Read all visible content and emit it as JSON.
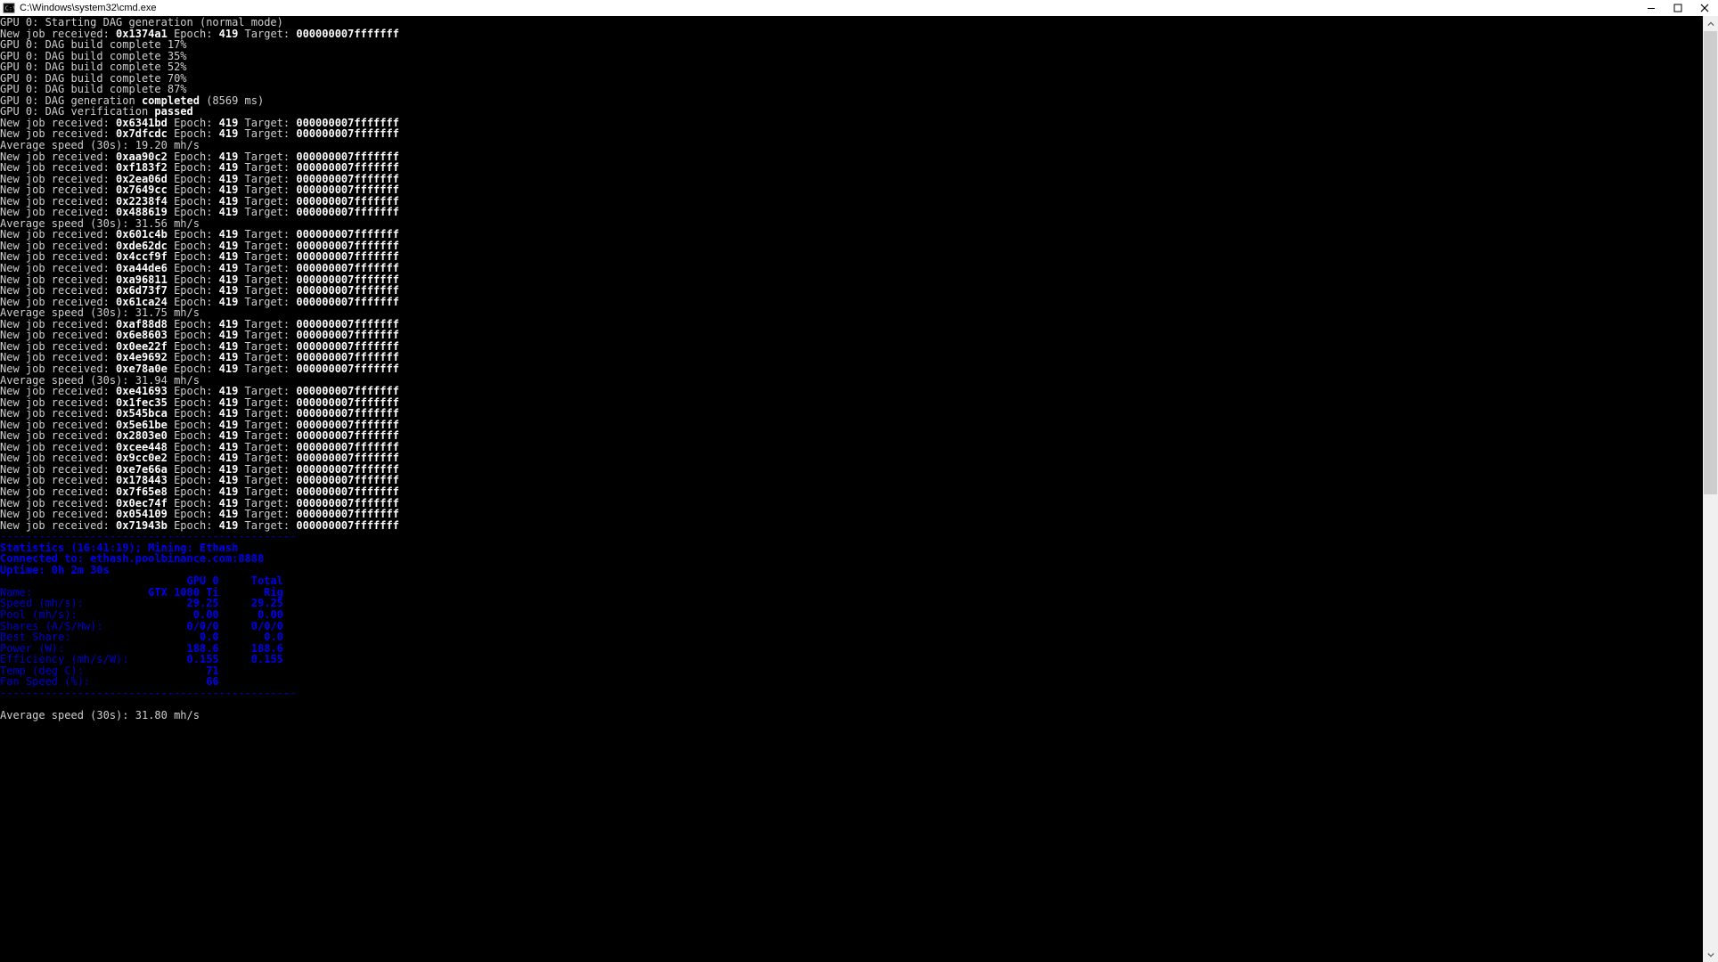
{
  "window": {
    "title": "C:\\Windows\\system32\\cmd.exe"
  },
  "log": {
    "epoch_label": "Epoch:",
    "epoch": "419",
    "target_label": "Target:",
    "target": "000000007fffffff",
    "lines": [
      "GPU 0: Starting DAG generation (normal mode)",
      {
        "job": "0x1374a1"
      },
      "GPU 0: DAG build complete 17%",
      "GPU 0: DAG build complete 35%",
      "GPU 0: DAG build complete 52%",
      "GPU 0: DAG build complete 70%",
      "GPU 0: DAG build complete 87%",
      {
        "dag_complete_prefix": "GPU 0: DAG generation ",
        "dag_complete_bold": "completed",
        "dag_complete_suffix": " (8569 ms)"
      },
      {
        "dag_verify_prefix": "GPU 0: DAG verification ",
        "dag_verify_bold": "passed"
      },
      {
        "job": "0x6341bd"
      },
      {
        "job": "0x7dfcdc"
      },
      "Average speed (30s): 19.20 mh/s",
      {
        "job": "0xaa90c2"
      },
      {
        "job": "0xf183f2"
      },
      {
        "job": "0x2ea06d"
      },
      {
        "job": "0x7649cc"
      },
      {
        "job": "0x2238f4"
      },
      {
        "job": "0x488619"
      },
      "Average speed (30s): 31.56 mh/s",
      {
        "job": "0x601c4b"
      },
      {
        "job": "0xde62dc"
      },
      {
        "job": "0x4ccf9f"
      },
      {
        "job": "0xa44de6"
      },
      {
        "job": "0xa96811"
      },
      {
        "job": "0x6d73f7"
      },
      {
        "job": "0x61ca24"
      },
      "Average speed (30s): 31.75 mh/s",
      {
        "job": "0xaf88d8"
      },
      {
        "job": "0x6e8603"
      },
      {
        "job": "0x0ee22f"
      },
      {
        "job": "0x4e9692"
      },
      {
        "job": "0xe78a0e"
      },
      "Average speed (30s): 31.94 mh/s",
      {
        "job": "0xe41693"
      },
      {
        "job": "0x1fec35"
      },
      {
        "job": "0x545bca"
      },
      {
        "job": "0x5e61be"
      },
      {
        "job": "0x2803e0"
      },
      {
        "job": "0xcee448"
      },
      {
        "job": "0x9cc0e2"
      },
      {
        "job": "0xe7e66a"
      },
      {
        "job": "0x178443"
      },
      {
        "job": "0x7f65e8"
      },
      {
        "job": "0x0ec74f"
      },
      {
        "job": "0x054109"
      },
      {
        "job": "0x71943b"
      }
    ]
  },
  "stats": {
    "dash_top": "----------------------------------------------",
    "header": "Statistics (16:41:19); Mining: Ethash",
    "connected": "Connected to: ethash.poolbinance.com:8888",
    "uptime": "Uptime: 0h 2m 30s",
    "col_gpu": "GPU 0",
    "col_total": "Total",
    "rows": [
      {
        "label": "Name:",
        "gpu": "GTX 1080 Ti",
        "total": "Rig"
      },
      {
        "label": "Speed (mh/s):",
        "gpu": "29.25",
        "total": "29.25"
      },
      {
        "label": "Pool (mh/s):",
        "gpu": "0.00",
        "total": "0.00"
      },
      {
        "label": "Shares (A/S/Hw):",
        "gpu": "0/0/0",
        "total": "0/0/0"
      },
      {
        "label": "Best Share:",
        "gpu": "0.0",
        "total": "0.0"
      },
      {
        "label": "Power (W):",
        "gpu": "188.6",
        "total": "188.6"
      },
      {
        "label": "Efficiency (mh/s/W):",
        "gpu": "0.155",
        "total": "0.155"
      },
      {
        "label": "Temp (deg C):",
        "gpu": "71",
        "total": ""
      },
      {
        "label": "Fan Speed (%):",
        "gpu": "66",
        "total": ""
      }
    ],
    "dash_bottom": "----------------------------------------------",
    "footer": "Average speed (30s): 31.80 mh/s"
  }
}
